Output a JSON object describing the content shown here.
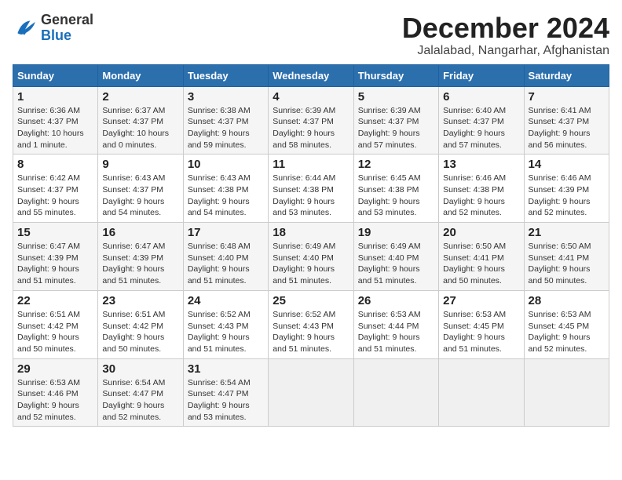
{
  "header": {
    "logo_general": "General",
    "logo_blue": "Blue",
    "title": "December 2024",
    "location": "Jalalabad, Nangarhar, Afghanistan"
  },
  "weekdays": [
    "Sunday",
    "Monday",
    "Tuesday",
    "Wednesday",
    "Thursday",
    "Friday",
    "Saturday"
  ],
  "weeks": [
    [
      {
        "day": "1",
        "sunrise": "6:36 AM",
        "sunset": "4:37 PM",
        "daylight": "10 hours and 1 minute."
      },
      {
        "day": "2",
        "sunrise": "6:37 AM",
        "sunset": "4:37 PM",
        "daylight": "10 hours and 0 minutes."
      },
      {
        "day": "3",
        "sunrise": "6:38 AM",
        "sunset": "4:37 PM",
        "daylight": "9 hours and 59 minutes."
      },
      {
        "day": "4",
        "sunrise": "6:39 AM",
        "sunset": "4:37 PM",
        "daylight": "9 hours and 58 minutes."
      },
      {
        "day": "5",
        "sunrise": "6:39 AM",
        "sunset": "4:37 PM",
        "daylight": "9 hours and 57 minutes."
      },
      {
        "day": "6",
        "sunrise": "6:40 AM",
        "sunset": "4:37 PM",
        "daylight": "9 hours and 57 minutes."
      },
      {
        "day": "7",
        "sunrise": "6:41 AM",
        "sunset": "4:37 PM",
        "daylight": "9 hours and 56 minutes."
      }
    ],
    [
      {
        "day": "8",
        "sunrise": "6:42 AM",
        "sunset": "4:37 PM",
        "daylight": "9 hours and 55 minutes."
      },
      {
        "day": "9",
        "sunrise": "6:43 AM",
        "sunset": "4:37 PM",
        "daylight": "9 hours and 54 minutes."
      },
      {
        "day": "10",
        "sunrise": "6:43 AM",
        "sunset": "4:38 PM",
        "daylight": "9 hours and 54 minutes."
      },
      {
        "day": "11",
        "sunrise": "6:44 AM",
        "sunset": "4:38 PM",
        "daylight": "9 hours and 53 minutes."
      },
      {
        "day": "12",
        "sunrise": "6:45 AM",
        "sunset": "4:38 PM",
        "daylight": "9 hours and 53 minutes."
      },
      {
        "day": "13",
        "sunrise": "6:46 AM",
        "sunset": "4:38 PM",
        "daylight": "9 hours and 52 minutes."
      },
      {
        "day": "14",
        "sunrise": "6:46 AM",
        "sunset": "4:39 PM",
        "daylight": "9 hours and 52 minutes."
      }
    ],
    [
      {
        "day": "15",
        "sunrise": "6:47 AM",
        "sunset": "4:39 PM",
        "daylight": "9 hours and 51 minutes."
      },
      {
        "day": "16",
        "sunrise": "6:47 AM",
        "sunset": "4:39 PM",
        "daylight": "9 hours and 51 minutes."
      },
      {
        "day": "17",
        "sunrise": "6:48 AM",
        "sunset": "4:40 PM",
        "daylight": "9 hours and 51 minutes."
      },
      {
        "day": "18",
        "sunrise": "6:49 AM",
        "sunset": "4:40 PM",
        "daylight": "9 hours and 51 minutes."
      },
      {
        "day": "19",
        "sunrise": "6:49 AM",
        "sunset": "4:40 PM",
        "daylight": "9 hours and 51 minutes."
      },
      {
        "day": "20",
        "sunrise": "6:50 AM",
        "sunset": "4:41 PM",
        "daylight": "9 hours and 50 minutes."
      },
      {
        "day": "21",
        "sunrise": "6:50 AM",
        "sunset": "4:41 PM",
        "daylight": "9 hours and 50 minutes."
      }
    ],
    [
      {
        "day": "22",
        "sunrise": "6:51 AM",
        "sunset": "4:42 PM",
        "daylight": "9 hours and 50 minutes."
      },
      {
        "day": "23",
        "sunrise": "6:51 AM",
        "sunset": "4:42 PM",
        "daylight": "9 hours and 50 minutes."
      },
      {
        "day": "24",
        "sunrise": "6:52 AM",
        "sunset": "4:43 PM",
        "daylight": "9 hours and 51 minutes."
      },
      {
        "day": "25",
        "sunrise": "6:52 AM",
        "sunset": "4:43 PM",
        "daylight": "9 hours and 51 minutes."
      },
      {
        "day": "26",
        "sunrise": "6:53 AM",
        "sunset": "4:44 PM",
        "daylight": "9 hours and 51 minutes."
      },
      {
        "day": "27",
        "sunrise": "6:53 AM",
        "sunset": "4:45 PM",
        "daylight": "9 hours and 51 minutes."
      },
      {
        "day": "28",
        "sunrise": "6:53 AM",
        "sunset": "4:45 PM",
        "daylight": "9 hours and 52 minutes."
      }
    ],
    [
      {
        "day": "29",
        "sunrise": "6:53 AM",
        "sunset": "4:46 PM",
        "daylight": "9 hours and 52 minutes."
      },
      {
        "day": "30",
        "sunrise": "6:54 AM",
        "sunset": "4:47 PM",
        "daylight": "9 hours and 52 minutes."
      },
      {
        "day": "31",
        "sunrise": "6:54 AM",
        "sunset": "4:47 PM",
        "daylight": "9 hours and 53 minutes."
      },
      null,
      null,
      null,
      null
    ]
  ]
}
